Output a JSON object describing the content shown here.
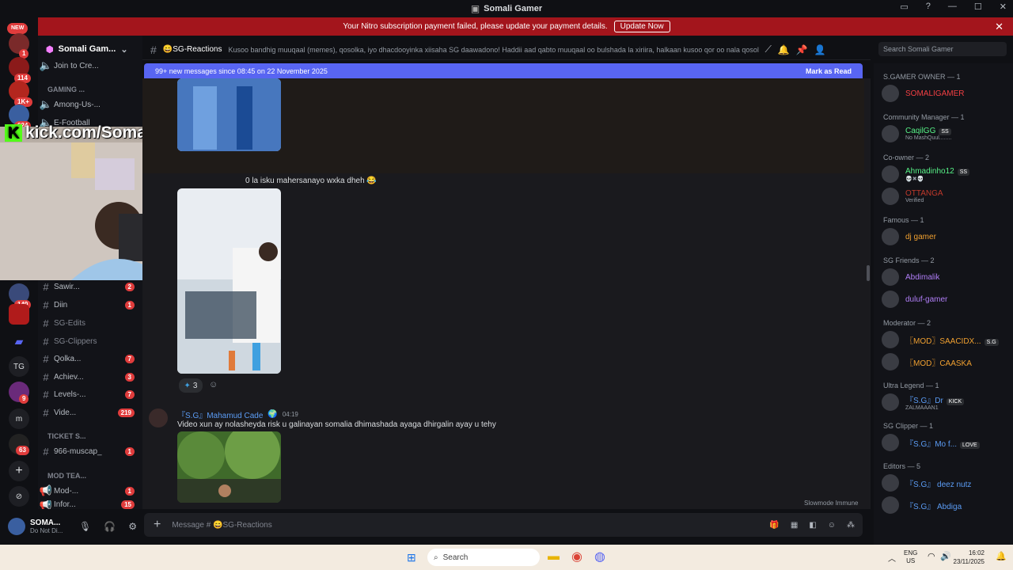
{
  "window": {
    "title": "Somali Gamer"
  },
  "banner": {
    "message": "Your Nitro subscription payment failed, please update your payment details.",
    "button": "Update Now"
  },
  "servers": {
    "new_label": "NEW",
    "badges": [
      "1",
      "114",
      "1K+",
      "624",
      "140",
      "9",
      "63"
    ],
    "tg_label": "TG",
    "m_label": "m"
  },
  "guild": {
    "name": "Somali Gam..."
  },
  "channels": {
    "items": [
      {
        "name": "Join to Cre...",
        "count": ""
      },
      {
        "name": "Among-Us-...",
        "count": ""
      },
      {
        "name": "E-Football",
        "count": ""
      },
      {
        "name": "Sawir...",
        "count": "2"
      },
      {
        "name": "Diin",
        "count": "1"
      },
      {
        "name": "SG-Edits",
        "count": ""
      },
      {
        "name": "SG-Clippers",
        "count": ""
      },
      {
        "name": "Qolka...",
        "count": "7"
      },
      {
        "name": "Achiev...",
        "count": "3"
      },
      {
        "name": "Levels-...",
        "count": "7"
      },
      {
        "name": "Vide...",
        "count": "219"
      },
      {
        "name": "966-muscap_",
        "count": "1"
      },
      {
        "name": "Mod-...",
        "count": "1"
      },
      {
        "name": "Infor...",
        "count": "15"
      }
    ],
    "categories": [
      "GAMING ...",
      "TICKET S...",
      "MOD TEA..."
    ]
  },
  "user": {
    "name": "SOMA...",
    "status": "Do Not Di..."
  },
  "channel_header": {
    "name": "SG-Reactions",
    "topic": "Kusoo bandhig muuqaal (memes), qosolka, iyo dhacdooyinka xiisaha SG daawadono! Haddii aad qabto muuqaal oo bulshada la xiriira, halkaan kusoo qor oo nala qosol."
  },
  "search": {
    "placeholder": "Search Somali Gamer"
  },
  "new_messages": {
    "text": "99+ new messages since 08:45 on 22 November 2025",
    "action": "Mark as Read"
  },
  "messages": [
    {
      "text": "0 la isku mahersanayo wxka dheh 😂"
    },
    {
      "author": "『S.G』Mahamud Cade",
      "time": "04:19",
      "text": "Video xun ay nolasheyda risk u galinayan somalia dhimashada ayaga dhirgalin ayay u tehy",
      "reaction_count": "3"
    }
  ],
  "slowmode": "Slowmode Immune",
  "composer": {
    "placeholder": "Message # 😄SG-Reactions"
  },
  "overlay": {
    "kick_text": "kick.com/SomaliGamer",
    "kick_letter": "K"
  },
  "members": {
    "groups": [
      {
        "label": "S.GAMER OWNER — 1",
        "members": [
          {
            "name": "SOMALIGAMER",
            "color": "#f23f43",
            "sub": ""
          }
        ]
      },
      {
        "label": "Community Manager — 1",
        "members": [
          {
            "name": "CaqilGG",
            "color": "#57f287",
            "sub": "No MashQuul........",
            "tag": "SS"
          }
        ]
      },
      {
        "label": "Co-owner — 2",
        "members": [
          {
            "name": "Ahmadinho12",
            "color": "#57f287",
            "sub": "💀✖💀",
            "tag": "SS"
          },
          {
            "name": "OTTANGA",
            "color": "#c0392b",
            "sub": "Verified"
          }
        ]
      },
      {
        "label": "Famous — 1",
        "members": [
          {
            "name": "dj gamer",
            "color": "#f0a030",
            "sub": ""
          }
        ]
      },
      {
        "label": "SG Friends — 2",
        "members": [
          {
            "name": "Abdimalik",
            "color": "#b07ef7",
            "sub": ""
          },
          {
            "name": "duluf-gamer",
            "color": "#b07ef7",
            "sub": ""
          }
        ]
      },
      {
        "label": "Moderator — 2",
        "members": [
          {
            "name": "〖MOD〗SAACIDX...",
            "color": "#f0a030",
            "sub": "",
            "tag": "S.G"
          },
          {
            "name": "〖MOD〗CAASKA",
            "color": "#f0a030",
            "sub": ""
          }
        ]
      },
      {
        "label": "Ultra Legend — 1",
        "members": [
          {
            "name": "『S.G』Dr",
            "color": "#5b9cf5",
            "sub": "ZALMAAAN1",
            "tag": "KICK"
          }
        ]
      },
      {
        "label": "SG Clipper — 1",
        "members": [
          {
            "name": "『S.G』Mo f...",
            "color": "#5b9cf5",
            "sub": "",
            "tag": "LOVE"
          }
        ]
      },
      {
        "label": "Editors — 5",
        "members": [
          {
            "name": "『S.G』 deez nutz",
            "color": "#5b9cf5",
            "sub": ""
          },
          {
            "name": "『S.G』 Abdiga",
            "color": "#5b9cf5",
            "sub": ""
          }
        ]
      }
    ]
  },
  "taskbar": {
    "search": "Search",
    "lang": "ENG",
    "region": "US",
    "time": "16:02",
    "date": "23/11/2025"
  }
}
